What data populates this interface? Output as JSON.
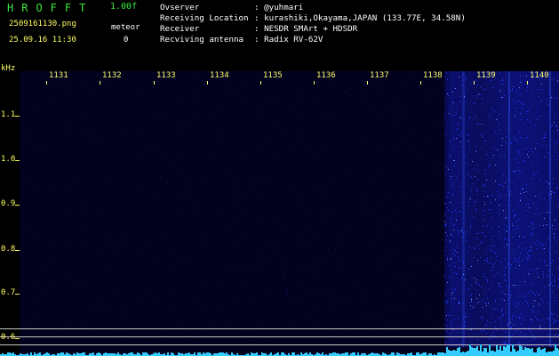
{
  "app": {
    "name": "HROFFT",
    "version": "1.00f"
  },
  "file": {
    "name": "2509161130.png",
    "mode": "meteor",
    "timestamp": "25.09.16 11:30",
    "count": "0"
  },
  "station": [
    {
      "label": "Ovserver",
      "value": ": @yuhmari"
    },
    {
      "label": "Receiving Location",
      "value": ": kurashiki,Okayama,JAPAN (133.77E, 34.58N)"
    },
    {
      "label": "Receiver",
      "value": ": NESDR SMArt + HDSDR"
    },
    {
      "label": "Recviving antenna",
      "value": ": Radix RV-62V"
    }
  ],
  "axes": {
    "x_unit": "kHz",
    "x_ticks": [
      "1131",
      "1132",
      "1133",
      "1134",
      "1135",
      "1136",
      "1137",
      "1138",
      "1139",
      "1140"
    ],
    "y_ticks": [
      "1.1",
      "1.0",
      "0.9",
      "0.8",
      "0.7",
      "0.6"
    ]
  },
  "colors": {
    "accent_green": "#39e639",
    "axis_yellow": "#ffff66",
    "text_white": "#ffffff",
    "spectrum_blue": "#1d3cff",
    "baseline_cyan": "#33ccff"
  }
}
